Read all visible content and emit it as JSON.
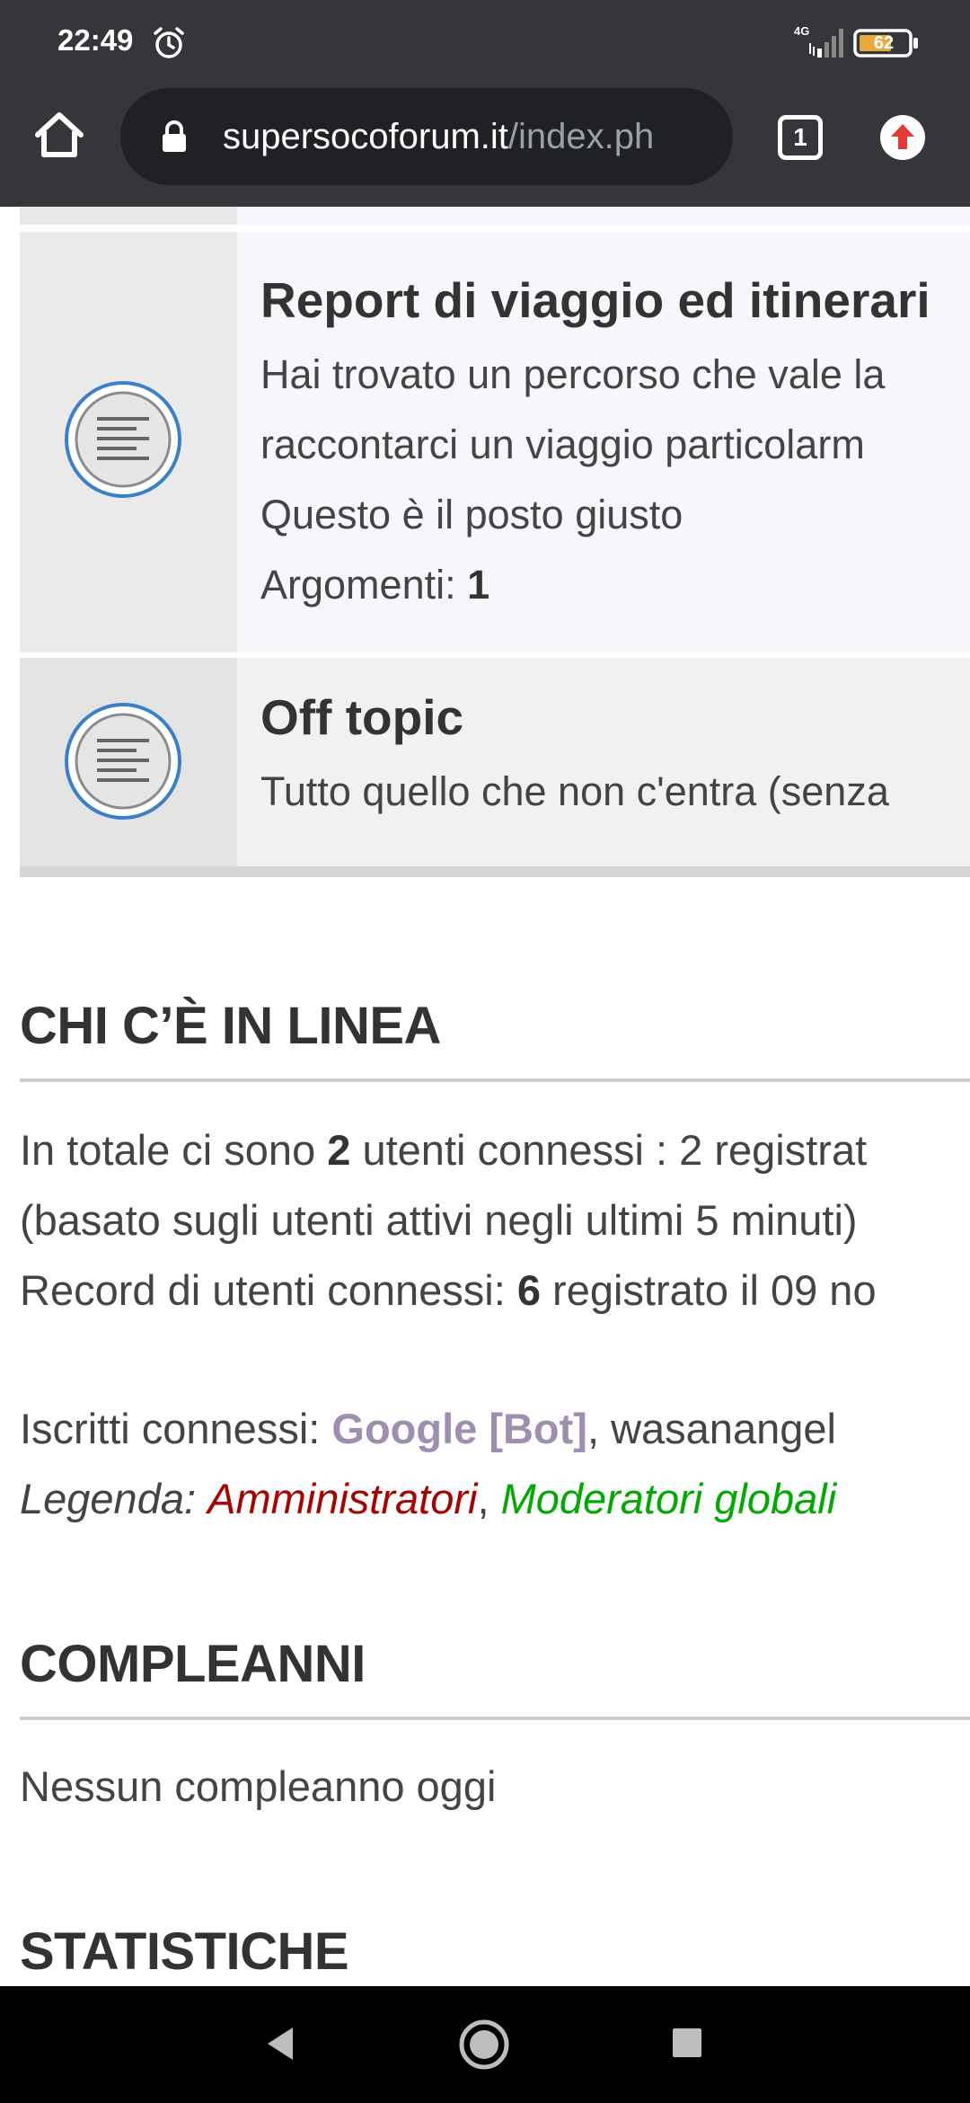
{
  "status_bar": {
    "time": "22:49",
    "network": "4G",
    "battery_level": "62",
    "icons": [
      "alarm-icon",
      "signal-icon",
      "battery-icon"
    ]
  },
  "browser": {
    "url_domain": "supersocoforum.it",
    "url_path": "/index.ph",
    "tab_count": "1",
    "icons": [
      "home-icon",
      "lock-icon",
      "tabs-icon",
      "update-icon"
    ]
  },
  "forums": [
    {
      "title": "Report di viaggio ed itinerari",
      "description_lines": [
        "Hai trovato un percorso che vale la",
        "raccontarci un viaggio particolarm",
        "Questo è il posto giusto"
      ],
      "topics_label": "Argomenti: ",
      "topics_count": "1",
      "icon": "forum-read-icon"
    },
    {
      "title": "Off topic",
      "description_lines": [
        "Tutto quello che non c'entra (senza"
      ],
      "icon": "forum-read-icon"
    }
  ],
  "who_is_online": {
    "heading": "CHI C’È IN LINEA",
    "line1_prefix": "In totale ci sono ",
    "line1_count": "2",
    "line1_suffix": " utenti connessi : 2 registrat",
    "line2": "(basato sugli utenti attivi negli ultimi 5 minuti)",
    "record_prefix": "Record di utenti connessi: ",
    "record_count": "6",
    "record_suffix": " registrato il 09 no",
    "registered_label": "Iscritti connessi: ",
    "bot_user": "Google [Bot]",
    "users_separator": ", ",
    "other_user": "wasanangel",
    "legend_label": "Legenda:",
    "legend_admin": "Amministratori",
    "legend_separator": ", ",
    "legend_mods": "Moderatori globali",
    "colors": {
      "admin": "#aa0000",
      "mods": "#00aa00",
      "bot": "#9e8fb0"
    }
  },
  "birthdays": {
    "heading": "COMPLEANNI",
    "text": "Nessun compleanno oggi"
  },
  "statistics": {
    "heading": "STATISTICHE"
  },
  "nav_bar": {
    "icons": [
      "back-icon",
      "home-circle-icon",
      "recents-icon"
    ]
  }
}
